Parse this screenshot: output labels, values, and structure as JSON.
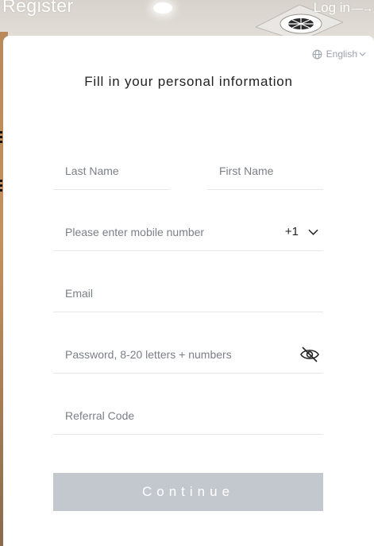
{
  "header": {
    "title": "Register",
    "login_label": "Log in",
    "login_arrow": "→"
  },
  "language": {
    "selected": "English",
    "chevron": "⌄"
  },
  "form": {
    "title": "Fill in your personal information",
    "last_name_placeholder": "Last Name",
    "first_name_placeholder": "First Name",
    "mobile_placeholder": "Please enter mobile number",
    "country_code": "+1",
    "email_placeholder": "Email",
    "password_placeholder": "Password, 8-20 letters + numbers",
    "referral_placeholder": "Referral Code",
    "continue_label": "Continue"
  },
  "colors": {
    "button_disabled": "#c3c8cf",
    "divider": "#e6e8eb",
    "placeholder": "#7b7f86",
    "muted": "#9aa1ab"
  },
  "icons": [
    "globe-icon",
    "chevron-down-icon",
    "eye-off-icon",
    "arrow-right-icon"
  ]
}
